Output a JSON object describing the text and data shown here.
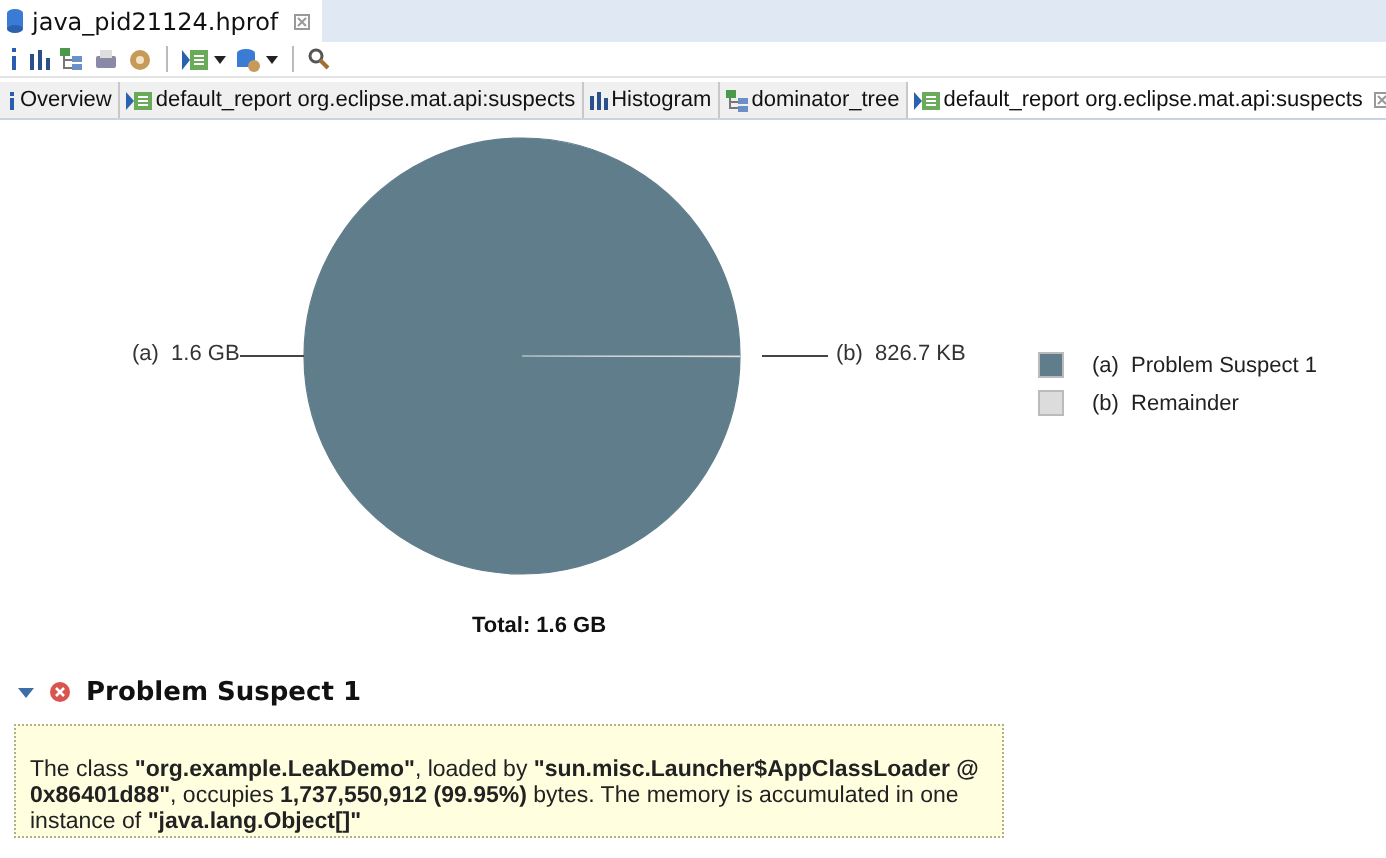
{
  "editor_tab": {
    "title": "java_pid21124.hprof",
    "selected": true
  },
  "page_tabs": [
    {
      "kind": "info",
      "label": "Overview",
      "selected": false
    },
    {
      "kind": "report",
      "label": "default_report  org.eclipse.mat.api:suspects",
      "selected": false
    },
    {
      "kind": "histogram",
      "label": "Histogram",
      "selected": false
    },
    {
      "kind": "tree",
      "label": "dominator_tree",
      "selected": false
    },
    {
      "kind": "report",
      "label": "default_report  org.eclipse.mat.api:suspects",
      "selected": true
    }
  ],
  "chart": {
    "chart_data": {
      "type": "pie",
      "categories": [
        "Problem Suspect 1",
        "Remainder"
      ],
      "values": [
        99.95,
        0.05
      ],
      "colors": [
        "#607d8b",
        "#dcdcdc"
      ]
    },
    "slice_labels": [
      {
        "letter": "(a)",
        "value": "1.6 GB"
      },
      {
        "letter": "(b)",
        "value": "826.7 KB"
      }
    ],
    "legend_letters": [
      "(a)",
      "(b)"
    ],
    "total": "Total: 1.6 GB"
  },
  "suspect": {
    "title": "Problem Suspect 1",
    "expanded": true,
    "description": "The class **\"org.example.LeakDemo\"**, loaded by **\"sun.misc.Launcher$AppClassLoader @ 0x86401d88\"**, occupies **1,737,550,912 (99.95%)** bytes. The memory is accumulated in one instance of **\"java.lang.Object[]\"**"
  }
}
